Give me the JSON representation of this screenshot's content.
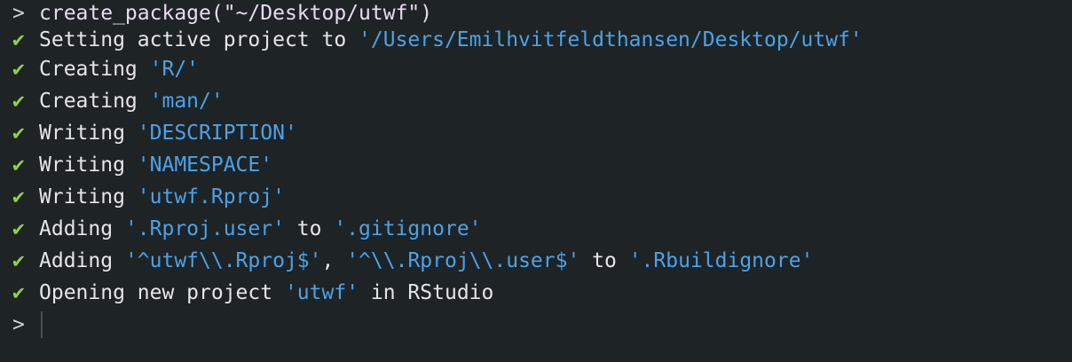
{
  "console": {
    "command": {
      "prompt": ">",
      "text": "create_package(\"~/Desktop/utwf\")"
    },
    "check_mark": "✔",
    "lines": [
      {
        "parts": [
          {
            "t": "plain",
            "v": "Setting active project to "
          },
          {
            "t": "quoted",
            "v": "'/Users/Emilhvitfeldthansen/Desktop/utwf'"
          }
        ]
      },
      {
        "parts": [
          {
            "t": "plain",
            "v": "Creating "
          },
          {
            "t": "quoted",
            "v": "'R/'"
          }
        ]
      },
      {
        "parts": [
          {
            "t": "plain",
            "v": "Creating "
          },
          {
            "t": "quoted",
            "v": "'man/'"
          }
        ]
      },
      {
        "parts": [
          {
            "t": "plain",
            "v": "Writing "
          },
          {
            "t": "quoted",
            "v": "'DESCRIPTION'"
          }
        ]
      },
      {
        "parts": [
          {
            "t": "plain",
            "v": "Writing "
          },
          {
            "t": "quoted",
            "v": "'NAMESPACE'"
          }
        ]
      },
      {
        "parts": [
          {
            "t": "plain",
            "v": "Writing "
          },
          {
            "t": "quoted",
            "v": "'utwf.Rproj'"
          }
        ]
      },
      {
        "parts": [
          {
            "t": "plain",
            "v": "Adding "
          },
          {
            "t": "quoted",
            "v": "'.Rproj.user'"
          },
          {
            "t": "plain",
            "v": " to "
          },
          {
            "t": "quoted",
            "v": "'.gitignore'"
          }
        ]
      },
      {
        "parts": [
          {
            "t": "plain",
            "v": "Adding "
          },
          {
            "t": "quoted",
            "v": "'^utwf\\\\.Rproj$'"
          },
          {
            "t": "plain",
            "v": ", "
          },
          {
            "t": "quoted",
            "v": "'^\\\\.Rproj\\\\.user$'"
          },
          {
            "t": "plain",
            "v": " to "
          },
          {
            "t": "quoted",
            "v": "'.Rbuildignore'"
          }
        ]
      },
      {
        "parts": [
          {
            "t": "plain",
            "v": "Opening new project "
          },
          {
            "t": "quoted",
            "v": "'utwf'"
          },
          {
            "t": "plain",
            "v": " in RStudio"
          }
        ]
      }
    ],
    "input": {
      "prompt": ">",
      "value": ""
    }
  },
  "colors": {
    "background": "#1e2326",
    "plain_text": "#e6e6e6",
    "quoted_text": "#4aa3e8",
    "check": "#8fd14f",
    "command": "#e3c3ff"
  }
}
